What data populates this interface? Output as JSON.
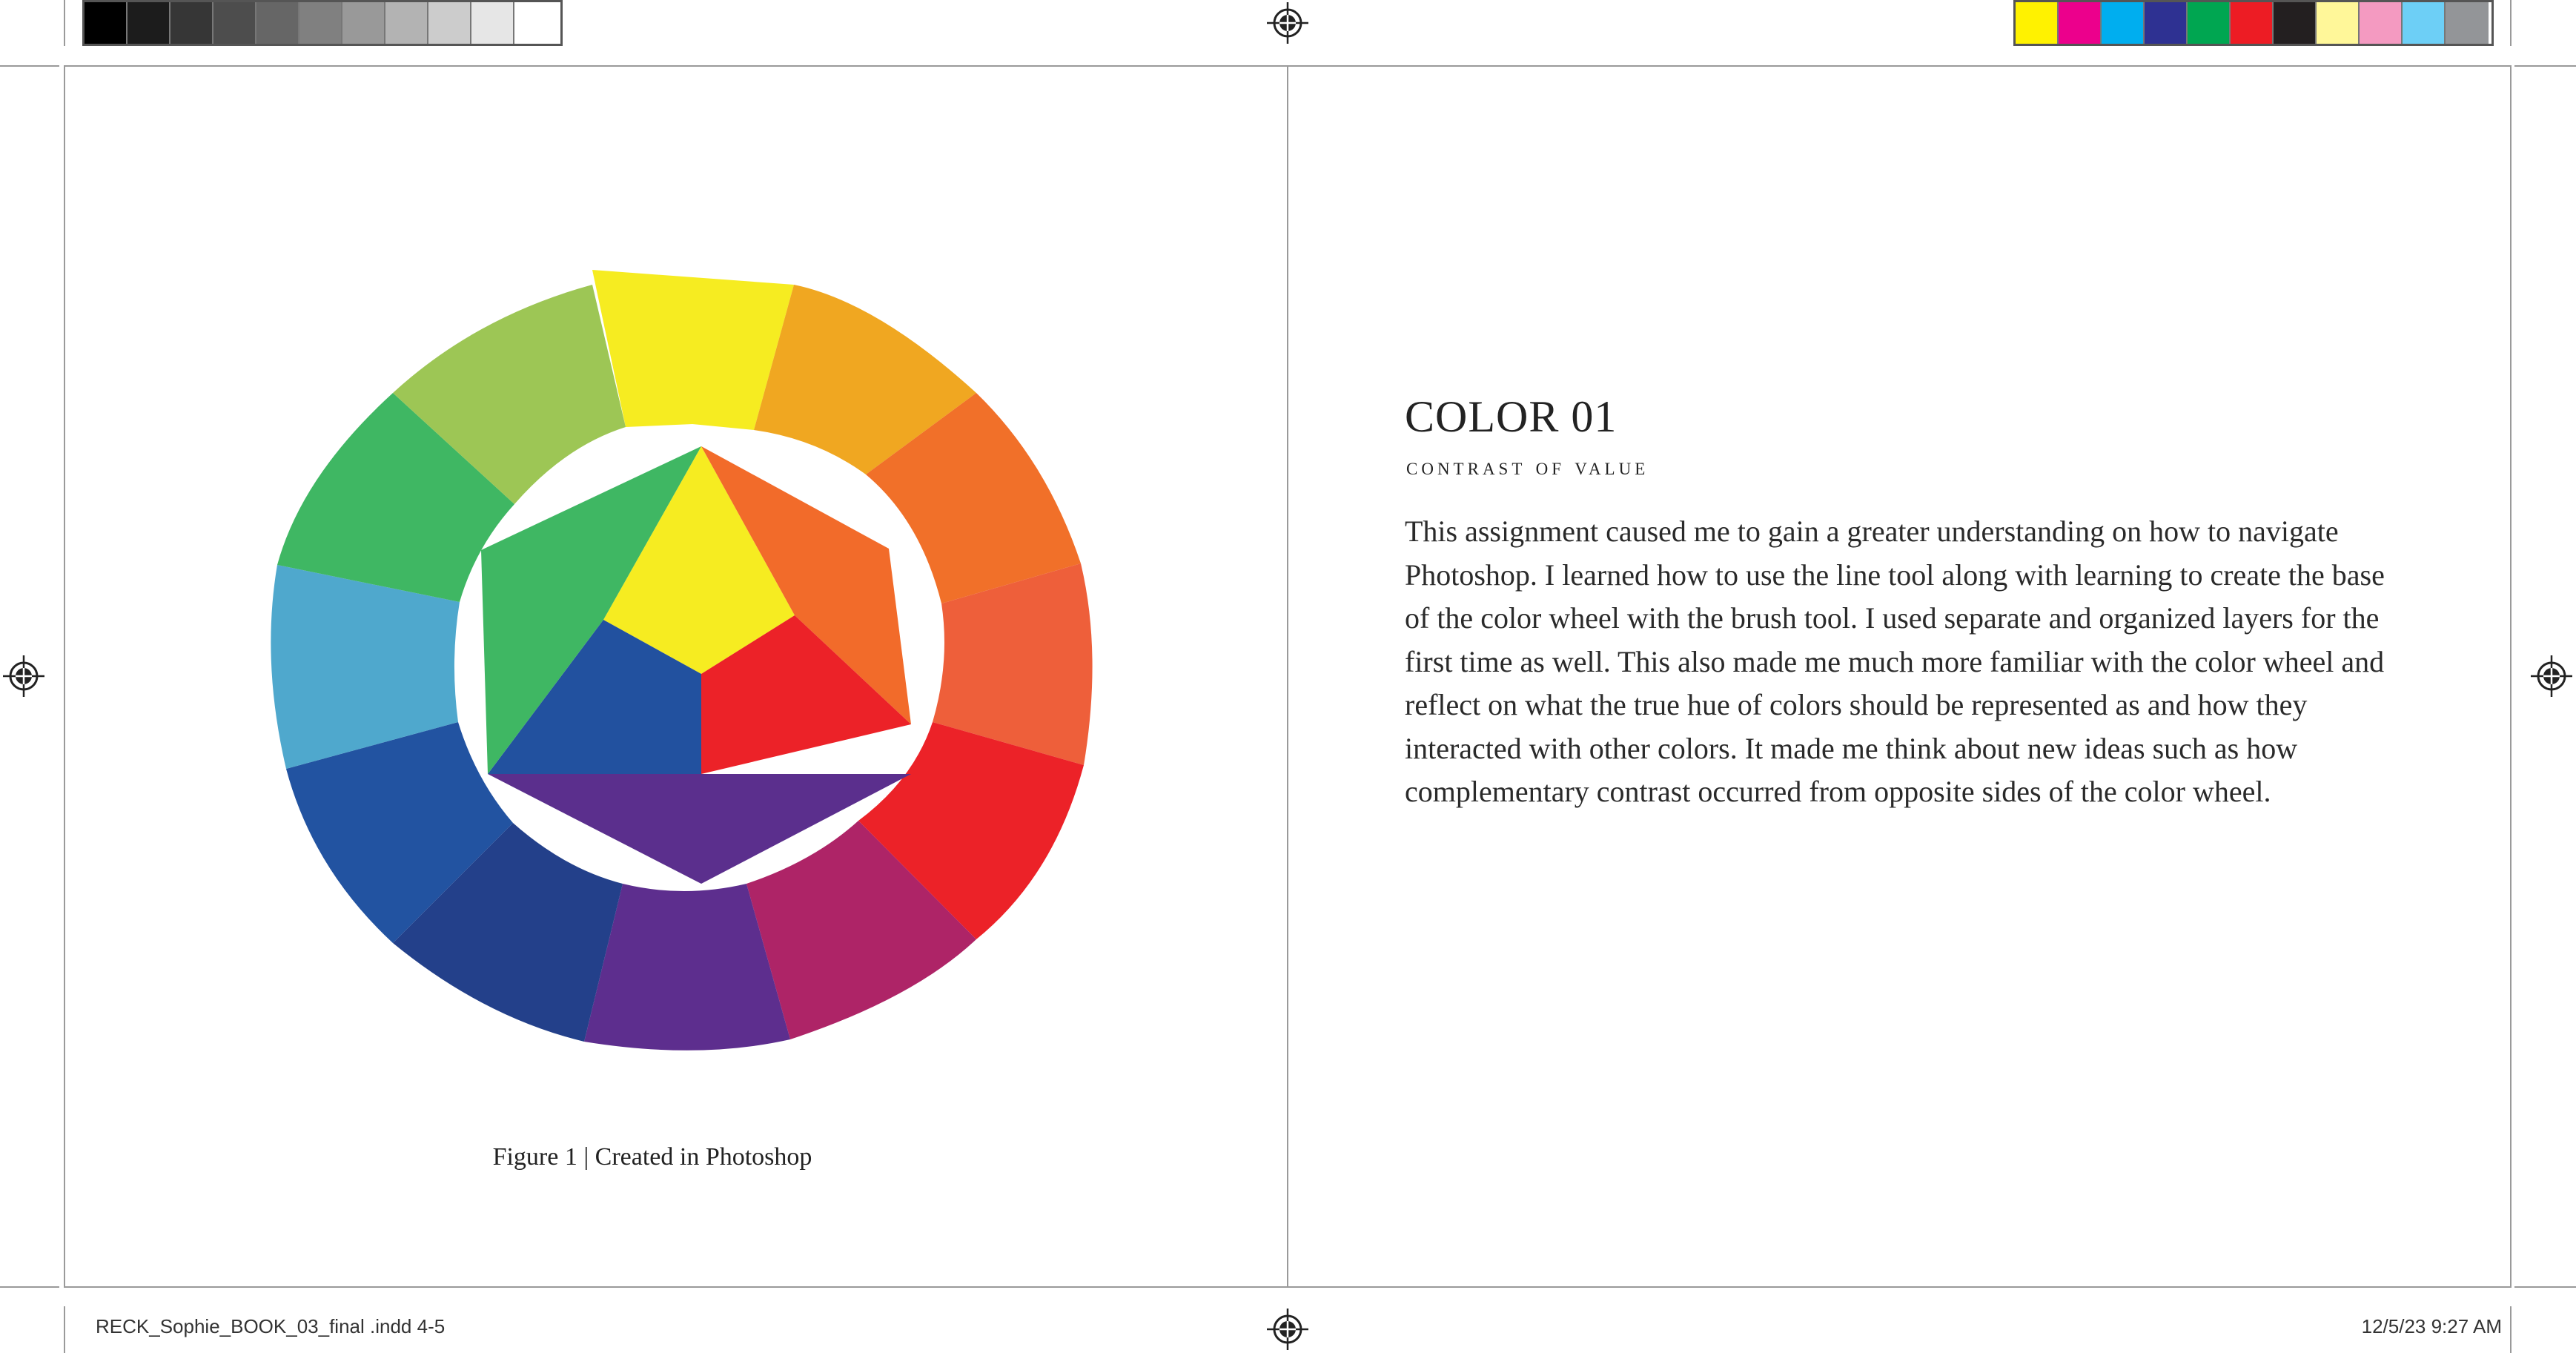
{
  "print_marks": {
    "gray_swatches": [
      "#000000",
      "#1c1c1c",
      "#363636",
      "#4d4d4d",
      "#666666",
      "#808080",
      "#999999",
      "#b3b3b3",
      "#cccccc",
      "#e6e6e6",
      "#ffffff"
    ],
    "color_swatches": [
      "#fff200",
      "#ec008c",
      "#00aeef",
      "#2e3192",
      "#00a651",
      "#ed1c24",
      "#231f20",
      "#fff799",
      "#f49ac1",
      "#6dcff6",
      "#939598"
    ]
  },
  "left_page": {
    "figure": {
      "colors": {
        "outer_yellow": "#f6ec21",
        "outer_yellow_orange": "#f0a721",
        "outer_orange": "#f17029",
        "outer_red_orange": "#ee5f3a",
        "outer_red": "#ec2228",
        "outer_red_violet": "#ae2467",
        "outer_violet": "#5d2e8e",
        "outer_blue_violet": "#23408a",
        "outer_blue": "#2253a1",
        "outer_light_blue": "#4fa8cd",
        "outer_green": "#3fb763",
        "outer_yellow_green": "#9dc655",
        "inner_yellow": "#f6ec21",
        "inner_orange": "#f26b2a",
        "inner_red": "#ec2228",
        "inner_blue": "#22519f",
        "inner_green": "#3fb763",
        "inner_violet": "#5b2f8d"
      }
    },
    "caption": "Figure 1 | Created in Photoshop"
  },
  "right_page": {
    "title": "COLOR 01",
    "subtitle": "CONTRAST OF VALUE",
    "body": "This assignment caused me to gain a greater understanding on how to navigate Photoshop. I learned how to use the line tool along with learning to create the base of the color wheel with the brush tool. I used separate and organized layers for the first time as well. This also made me much more familiar with the color wheel and reflect on what the true hue of colors should be represented as and how they interacted with other colors. It made me think about new ideas such as how complementary contrast occurred from opposite sides of the color wheel."
  },
  "slug": {
    "file": "RECK_Sophie_BOOK_03_final .indd   4-5",
    "date": "12/5/23   9:27 AM"
  }
}
